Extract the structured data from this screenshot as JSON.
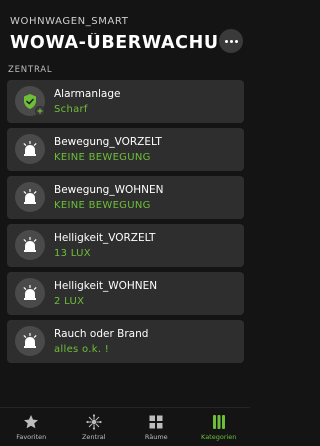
{
  "header": {
    "app_name": "WOHNWAGEN_SMART",
    "title": "WOWA-ÜBERWACHU..."
  },
  "section": {
    "label": "ZENTRAL"
  },
  "devices": [
    {
      "name": "Alarmanlage",
      "status": "Scharf",
      "icon": "shield-check-icon"
    },
    {
      "name": "Bewegung_VORZELT",
      "status": "KEINE BEWEGUNG",
      "icon": "siren-icon"
    },
    {
      "name": "Bewegung_WOHNEN",
      "status": "KEINE BEWEGUNG",
      "icon": "siren-icon"
    },
    {
      "name": "Helligkeit_VORZELT",
      "status": "13 LUX",
      "icon": "siren-icon"
    },
    {
      "name": "Helligkeit_WOHNEN",
      "status": "2 LUX",
      "icon": "siren-icon"
    },
    {
      "name": "Rauch oder Brand",
      "status": "alles o.k. !",
      "icon": "siren-icon"
    }
  ],
  "nav": [
    {
      "label": "Favoriten",
      "icon": "star-icon"
    },
    {
      "label": "Zentral",
      "icon": "hub-icon"
    },
    {
      "label": "Räume",
      "icon": "grid-icon"
    },
    {
      "label": "Kategorien",
      "icon": "categories-icon",
      "active": true
    }
  ],
  "colors": {
    "background": "#141414",
    "card": "#2e2e2e",
    "accent": "#6dbf3a"
  }
}
